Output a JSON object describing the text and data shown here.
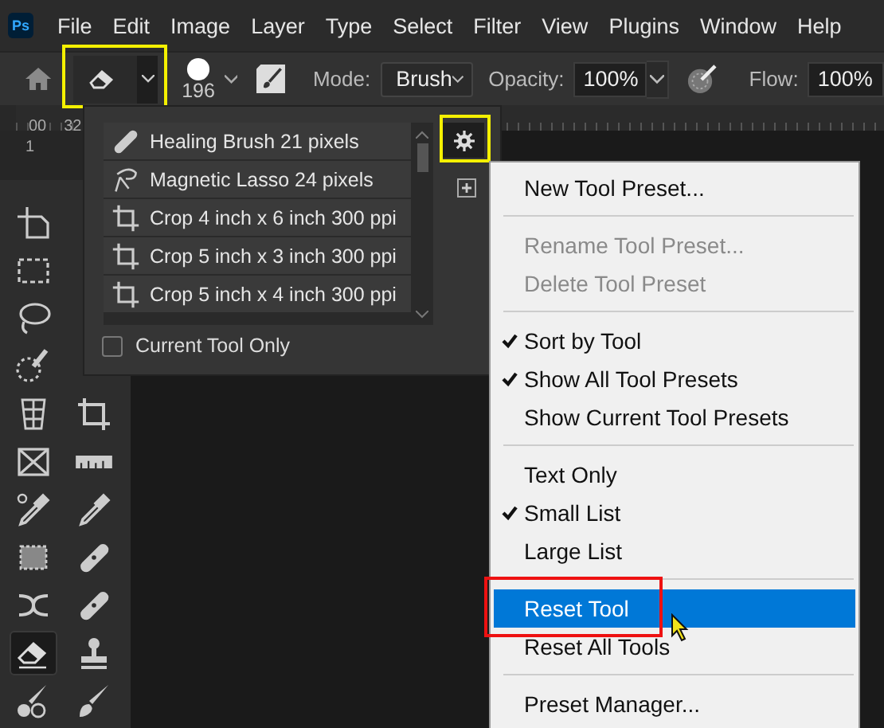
{
  "menubar": {
    "logo": "Ps",
    "items": [
      "File",
      "Edit",
      "Image",
      "Layer",
      "Type",
      "Select",
      "Filter",
      "View",
      "Plugins",
      "Window",
      "Help"
    ]
  },
  "options_bar": {
    "brush_size": "196",
    "mode_label": "Mode:",
    "mode": "Brush",
    "opacity_label": "Opacity:",
    "opacity": "100%",
    "flow_label": "Flow:",
    "flow": "100%"
  },
  "ruler": {
    "labels": [
      "00",
      "32"
    ],
    "side_label": "1"
  },
  "tool_rows": [
    {
      "left": {
        "kind": "artboard",
        "selected": false
      }
    },
    {
      "left": {
        "kind": "marquee",
        "selected": false
      }
    },
    {
      "left": {
        "kind": "lasso",
        "selected": false
      }
    },
    {
      "left": {
        "kind": "quick-select",
        "selected": false
      }
    },
    {
      "left": {
        "kind": "perspective",
        "selected": false
      },
      "right": {
        "kind": "crop",
        "selected": false
      }
    },
    {
      "left": {
        "kind": "frame",
        "selected": false
      },
      "right": {
        "kind": "ruler",
        "selected": false
      }
    },
    {
      "left": {
        "kind": "sampler",
        "selected": false
      },
      "right": {
        "kind": "eyedropper",
        "selected": false
      }
    },
    {
      "left": {
        "kind": "patch",
        "selected": false
      },
      "right": {
        "kind": "healing",
        "selected": false
      }
    },
    {
      "left": {
        "kind": "move",
        "selected": false
      },
      "right": {
        "kind": "healing",
        "selected": false
      }
    },
    {
      "left": {
        "kind": "eraser",
        "selected": true
      },
      "right": {
        "kind": "stamp",
        "selected": false
      }
    },
    {
      "left": {
        "kind": "history",
        "selected": false
      },
      "right": {
        "kind": "brush",
        "selected": false
      }
    }
  ],
  "preset_panel": {
    "presets": [
      {
        "kind": "healing",
        "label": "Healing Brush 21 pixels"
      },
      {
        "kind": "lasso",
        "label": "Magnetic Lasso 24 pixels"
      },
      {
        "kind": "crop",
        "label": "Crop 4 inch x 6 inch 300 ppi"
      },
      {
        "kind": "crop",
        "label": "Crop 5 inch x 3 inch 300 ppi"
      },
      {
        "kind": "crop",
        "label": "Crop 5 inch x 4 inch 300 ppi"
      }
    ],
    "current_tool_only": {
      "label": "Current Tool Only",
      "checked": false
    }
  },
  "menu": {
    "sections": [
      [
        {
          "label": "New Tool Preset...",
          "checked": false,
          "disabled": false,
          "selected": false
        }
      ],
      [
        {
          "label": "Rename Tool Preset...",
          "checked": false,
          "disabled": true,
          "selected": false
        },
        {
          "label": "Delete Tool Preset",
          "checked": false,
          "disabled": true,
          "selected": false
        }
      ],
      [
        {
          "label": "Sort by Tool",
          "checked": true,
          "disabled": false,
          "selected": false
        },
        {
          "label": "Show All Tool Presets",
          "checked": true,
          "disabled": false,
          "selected": false
        },
        {
          "label": "Show Current Tool Presets",
          "checked": false,
          "disabled": false,
          "selected": false
        }
      ],
      [
        {
          "label": "Text Only",
          "checked": false,
          "disabled": false,
          "selected": false
        },
        {
          "label": "Small List",
          "checked": true,
          "disabled": false,
          "selected": false
        },
        {
          "label": "Large List",
          "checked": false,
          "disabled": false,
          "selected": false
        }
      ],
      [
        {
          "label": "Reset Tool",
          "checked": false,
          "disabled": false,
          "selected": true
        },
        {
          "label": "Reset All Tools",
          "checked": false,
          "disabled": false,
          "selected": false
        }
      ],
      [
        {
          "label": "Preset Manager...",
          "checked": false,
          "disabled": false,
          "selected": false
        }
      ]
    ]
  }
}
